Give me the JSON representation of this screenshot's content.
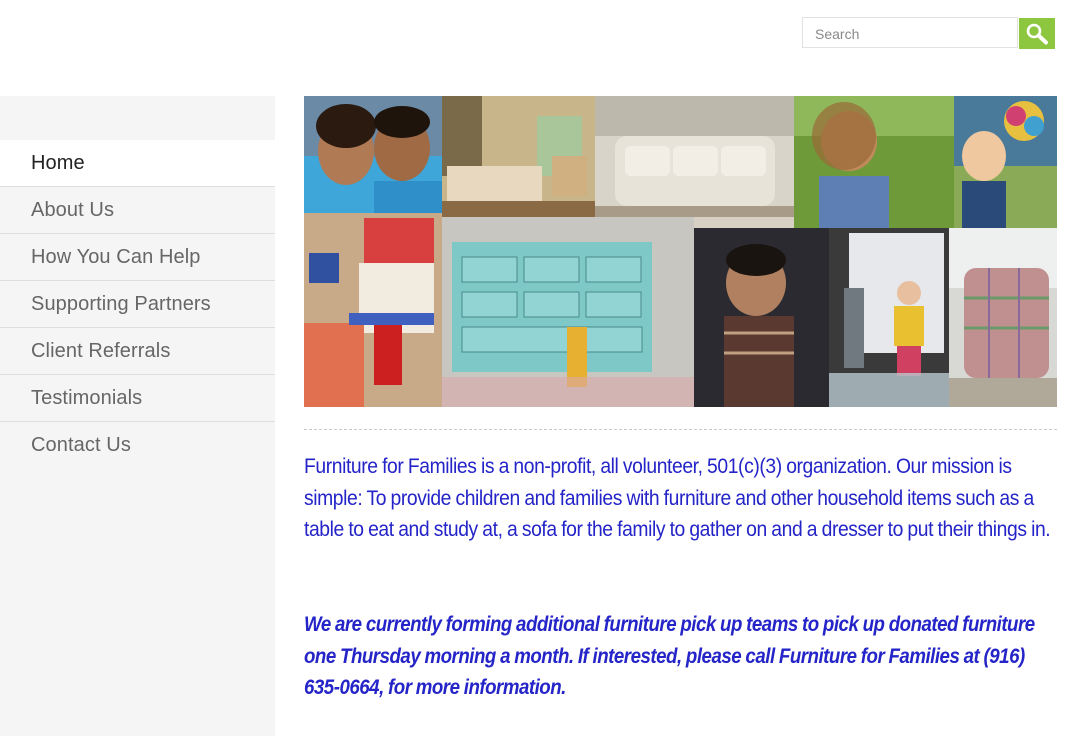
{
  "search": {
    "placeholder": "Search",
    "button_icon": "search-icon",
    "button_color": "#8dc63f"
  },
  "nav": {
    "items": [
      {
        "label": "Home",
        "active": true
      },
      {
        "label": "About Us"
      },
      {
        "label": "How You Can Help"
      },
      {
        "label": "Supporting Partners"
      },
      {
        "label": "Client Referrals"
      },
      {
        "label": "Testimonials"
      },
      {
        "label": "Contact Us"
      }
    ]
  },
  "hero": {
    "image": "collage of children and furniture photos"
  },
  "content": {
    "mission": "Furniture for Families is a non-profit, all volunteer, 501(c)(3) organization. Our mission is simple: To provide children and families with furniture and other household items such as a table to eat and study at, a sofa for the family to gather on and a dresser to put their things in.",
    "callout": "We are currently forming additional furniture pick up teams to pick up donated furniture one Thursday morning a month. If interested, please call Furniture for Families at (916) 635-0664, for more information.",
    "text_color": "#2424c8"
  }
}
